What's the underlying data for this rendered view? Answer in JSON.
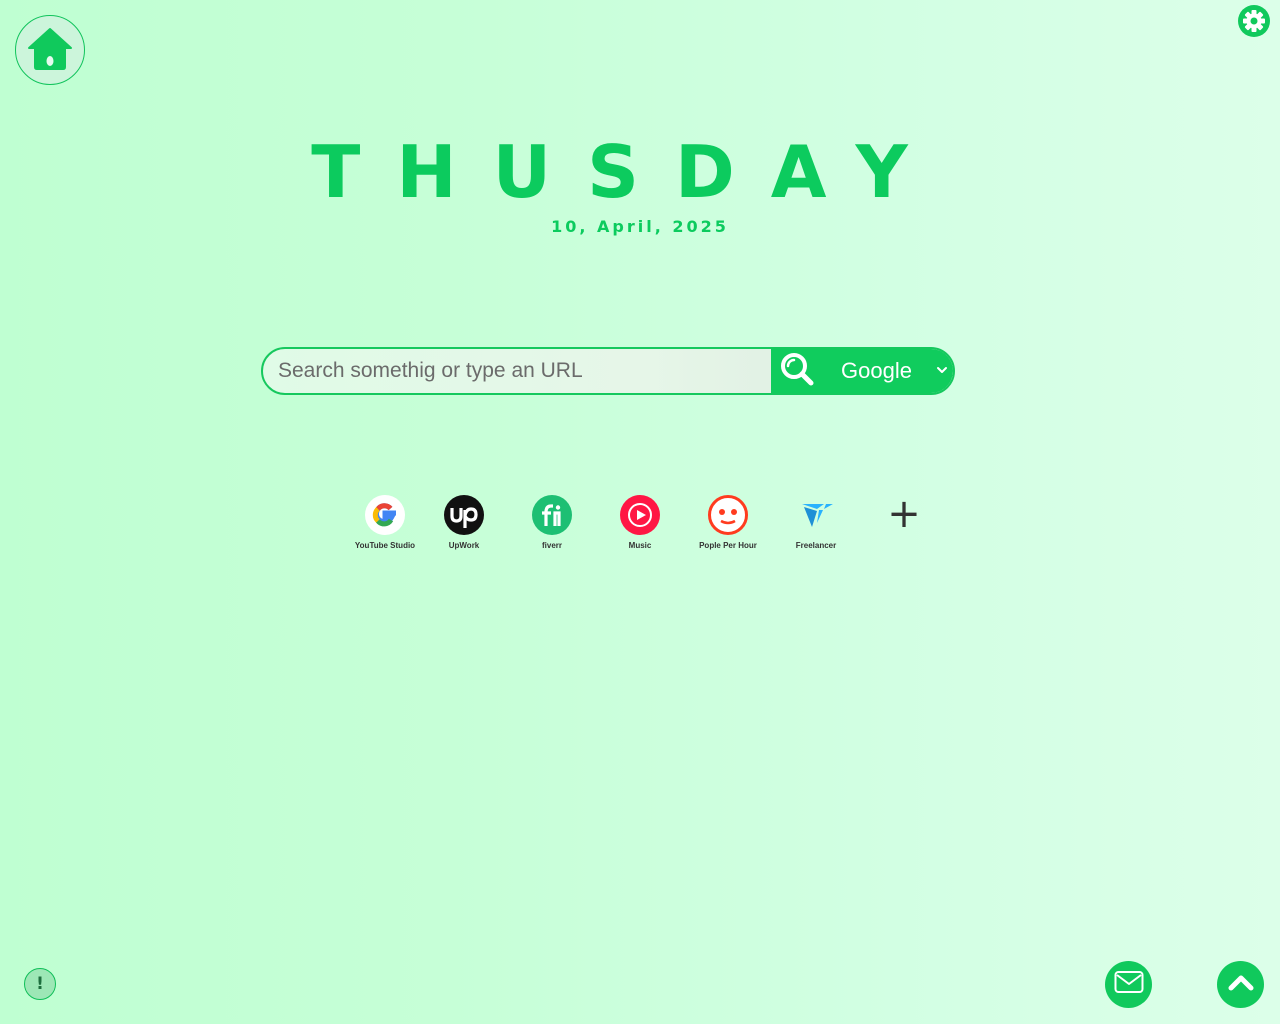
{
  "header": {
    "day": "THUSDAY",
    "date": "10, April, 2025"
  },
  "search": {
    "placeholder": "Search somethig or type an URL",
    "value": "",
    "engine": "Google"
  },
  "shortcuts": [
    {
      "label": "YouTube Studio",
      "icon": "google-icon"
    },
    {
      "label": "UpWork",
      "icon": "upwork-icon"
    },
    {
      "label": "fiverr",
      "icon": "fiverr-icon"
    },
    {
      "label": "Music",
      "icon": "music-icon"
    },
    {
      "label": "Pople Per Hour",
      "icon": "people-per-hour-icon"
    },
    {
      "label": "Freelancer",
      "icon": "freelancer-icon"
    }
  ],
  "add_shortcut": {
    "label": "+"
  },
  "info": {
    "label": "!"
  },
  "theme": {
    "accent": "#10cc5d",
    "background": "#c6ffd7"
  }
}
